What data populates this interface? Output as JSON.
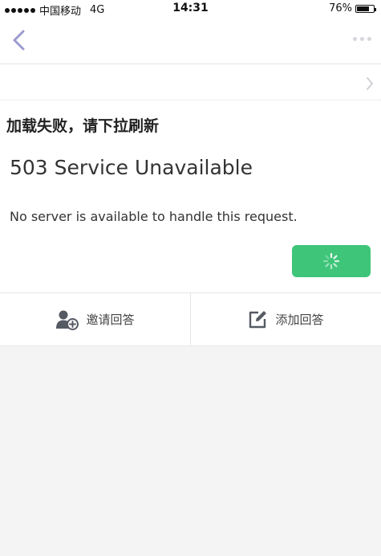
{
  "status_bar": {
    "carrier": "中国移动",
    "network": "4G",
    "time": "14:31",
    "battery_percent": "76%",
    "battery_level": 0.76
  },
  "nav": {
    "back_icon": "chevron-left-icon",
    "more_icon": "more-dots-icon"
  },
  "content": {
    "error_title": "加载失败，请下拉刷新",
    "error_heading": "503 Service Unavailable",
    "error_message": "No server is available to handle this request.",
    "button_state": "loading"
  },
  "actions": {
    "invite_label": "邀请回答",
    "add_label": "添加回答"
  },
  "colors": {
    "accent_green": "#3ec57a",
    "nav_icon": "#9b9bcf",
    "action_icon": "#555a63"
  }
}
